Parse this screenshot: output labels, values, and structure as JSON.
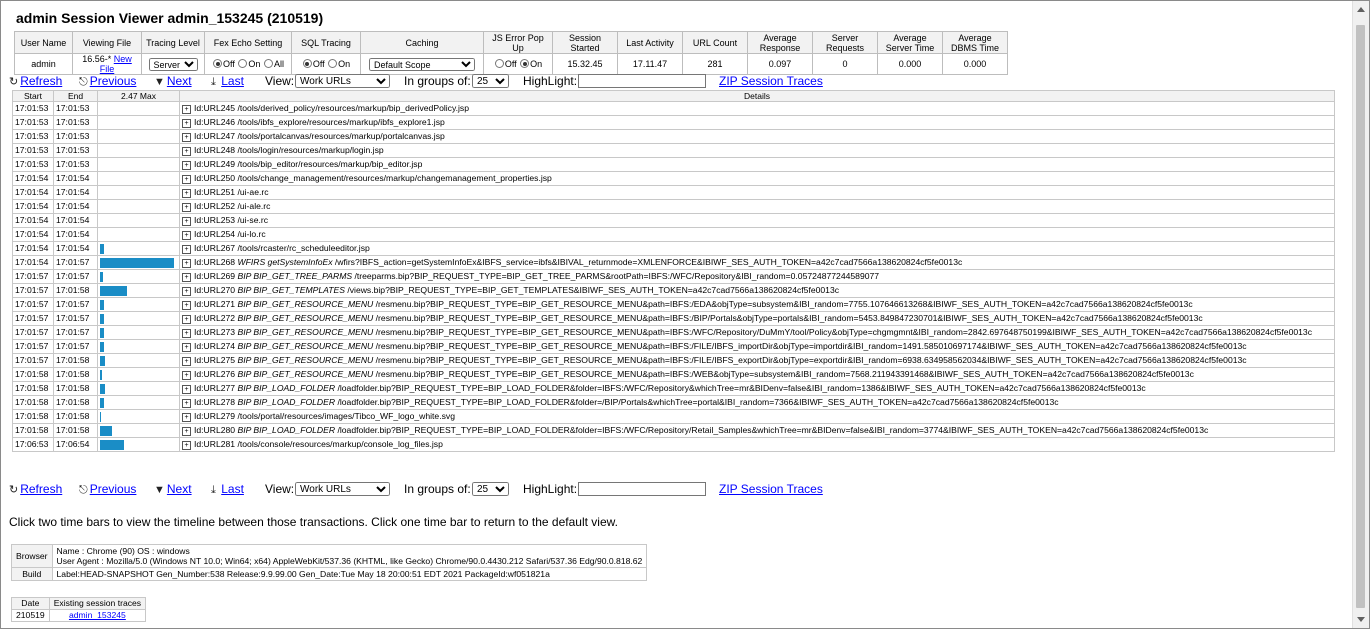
{
  "title": "admin Session Viewer admin_153245 (210519)",
  "summary": {
    "headers": [
      "User Name",
      "Viewing File",
      "Tracing Level",
      "Fex Echo Setting",
      "SQL Tracing",
      "Caching",
      "JS Error Pop Up",
      "Session Started",
      "Last Activity",
      "URL Count",
      "Average Response",
      "Server Requests",
      "Average Server Time",
      "Average DBMS Time"
    ],
    "user": "admin",
    "viewing_file": "16.56-*",
    "new_file_link": "New File",
    "tracing_level": "Server",
    "fex_echo": [
      "Off",
      "On",
      "All"
    ],
    "sql_tracing": [
      "Off",
      "On"
    ],
    "caching": "Default Scope",
    "js_error": [
      "Off",
      "On"
    ],
    "session_started": "15.32.45",
    "last_activity": "17.11.47",
    "url_count": "281",
    "avg_response": "0.097",
    "server_requests": "0",
    "avg_server_time": "0.000",
    "avg_dbms_time": "0.000"
  },
  "toolbar": {
    "refresh": "Refresh",
    "previous": "Previous",
    "next": "Next",
    "last": "Last",
    "view_label": "View:",
    "view_value": "Work URLs",
    "groups_label": "In groups of:",
    "groups_value": "25",
    "highlight_label": "HighLight:",
    "zip": "ZIP Session Traces"
  },
  "grid": {
    "headers": [
      "Start",
      "End",
      "2.47 Max",
      "Details"
    ],
    "rows": [
      {
        "start": "17:01:53",
        "end": "17:01:53",
        "bar": 0,
        "id": "Id:URL245",
        "label": "",
        "path": "/tools/derived_policy/resources/markup/bip_derivedPolicy.jsp"
      },
      {
        "start": "17:01:53",
        "end": "17:01:53",
        "bar": 0,
        "id": "Id:URL246",
        "label": "",
        "path": "/tools/ibfs_explore/resources/markup/ibfs_explore1.jsp"
      },
      {
        "start": "17:01:53",
        "end": "17:01:53",
        "bar": 0,
        "id": "Id:URL247",
        "label": "",
        "path": "/tools/portalcanvas/resources/markup/portalcanvas.jsp"
      },
      {
        "start": "17:01:53",
        "end": "17:01:53",
        "bar": 0,
        "id": "Id:URL248",
        "label": "",
        "path": "/tools/login/resources/markup/login.jsp"
      },
      {
        "start": "17:01:53",
        "end": "17:01:53",
        "bar": 0,
        "id": "Id:URL249",
        "label": "",
        "path": "/tools/bip_editor/resources/markup/bip_editor.jsp"
      },
      {
        "start": "17:01:54",
        "end": "17:01:54",
        "bar": 0,
        "id": "Id:URL250",
        "label": "",
        "path": "/tools/change_management/resources/markup/changemanagement_properties.jsp"
      },
      {
        "start": "17:01:54",
        "end": "17:01:54",
        "bar": 0,
        "id": "Id:URL251",
        "label": "",
        "path": "/ui-ae.rc"
      },
      {
        "start": "17:01:54",
        "end": "17:01:54",
        "bar": 0,
        "id": "Id:URL252",
        "label": "",
        "path": "/ui-ale.rc"
      },
      {
        "start": "17:01:54",
        "end": "17:01:54",
        "bar": 0,
        "id": "Id:URL253",
        "label": "",
        "path": "/ui-se.rc"
      },
      {
        "start": "17:01:54",
        "end": "17:01:54",
        "bar": 0,
        "id": "Id:URL254",
        "label": "",
        "path": "/ui-lo.rc"
      },
      {
        "start": "17:01:54",
        "end": "17:01:54",
        "bar": 0.05,
        "id": "Id:URL267",
        "label": "",
        "path": "/tools/rcaster/rc_scheduleeditor.jsp"
      },
      {
        "start": "17:01:54",
        "end": "17:01:57",
        "bar": 1,
        "id": "Id:URL268",
        "label": "WFIRS getSystemInfoEx",
        "path": "/wfirs?IBFS_action=getSystemInfoEx&IBFS_service=ibfs&IBIVAL_returnmode=XMLENFORCE&IBIWF_SES_AUTH_TOKEN=a42c7cad7566a138620824cf5fe0013c"
      },
      {
        "start": "17:01:57",
        "end": "17:01:57",
        "bar": 0.04,
        "id": "Id:URL269",
        "label": "BIP BIP_GET_TREE_PARMS",
        "path": "/treeparms.bip?BIP_REQUEST_TYPE=BIP_GET_TREE_PARMS&rootPath=IBFS:/WFC/Repository&IBI_random=0.05724877244589077"
      },
      {
        "start": "17:01:57",
        "end": "17:01:58",
        "bar": 0.36,
        "id": "Id:URL270",
        "label": "BIP BIP_GET_TEMPLATES",
        "path": "/views.bip?BIP_REQUEST_TYPE=BIP_GET_TEMPLATES&IBIWF_SES_AUTH_TOKEN=a42c7cad7566a138620824cf5fe0013c"
      },
      {
        "start": "17:01:57",
        "end": "17:01:57",
        "bar": 0.06,
        "id": "Id:URL271",
        "label": "BIP BIP_GET_RESOURCE_MENU",
        "path": "/resmenu.bip?BIP_REQUEST_TYPE=BIP_GET_RESOURCE_MENU&path=IBFS:/EDA&objType=subsystem&IBI_random=7755.107646613268&IBIWF_SES_AUTH_TOKEN=a42c7cad7566a138620824cf5fe0013c"
      },
      {
        "start": "17:01:57",
        "end": "17:01:57",
        "bar": 0.05,
        "id": "Id:URL272",
        "label": "BIP BIP_GET_RESOURCE_MENU",
        "path": "/resmenu.bip?BIP_REQUEST_TYPE=BIP_GET_RESOURCE_MENU&path=IBFS:/BIP/Portals&objType=portals&IBI_random=5453.849847230701&IBIWF_SES_AUTH_TOKEN=a42c7cad7566a138620824cf5fe0013c"
      },
      {
        "start": "17:01:57",
        "end": "17:01:57",
        "bar": 0.05,
        "id": "Id:URL273",
        "label": "BIP BIP_GET_RESOURCE_MENU",
        "path": "/resmenu.bip?BIP_REQUEST_TYPE=BIP_GET_RESOURCE_MENU&path=IBFS:/WFC/Repository/DuMmY/tool/Policy&objType=chgmgmnt&IBI_random=2842.697648750199&IBIWF_SES_AUTH_TOKEN=a42c7cad7566a138620824cf5fe0013c"
      },
      {
        "start": "17:01:57",
        "end": "17:01:57",
        "bar": 0.05,
        "id": "Id:URL274",
        "label": "BIP BIP_GET_RESOURCE_MENU",
        "path": "/resmenu.bip?BIP_REQUEST_TYPE=BIP_GET_RESOURCE_MENU&path=IBFS:/FILE/IBFS_importDir&objType=importdir&IBI_random=1491.585010697174&IBIWF_SES_AUTH_TOKEN=a42c7cad7566a138620824cf5fe0013c"
      },
      {
        "start": "17:01:57",
        "end": "17:01:58",
        "bar": 0.07,
        "id": "Id:URL275",
        "label": "BIP BIP_GET_RESOURCE_MENU",
        "path": "/resmenu.bip?BIP_REQUEST_TYPE=BIP_GET_RESOURCE_MENU&path=IBFS:/FILE/IBFS_exportDir&objType=exportdir&IBI_random=6938.634958562034&IBIWF_SES_AUTH_TOKEN=a42c7cad7566a138620824cf5fe0013c"
      },
      {
        "start": "17:01:58",
        "end": "17:01:58",
        "bar": 0.03,
        "id": "Id:URL276",
        "label": "BIP BIP_GET_RESOURCE_MENU",
        "path": "/resmenu.bip?BIP_REQUEST_TYPE=BIP_GET_RESOURCE_MENU&path=IBFS:/WEB&objType=subsystem&IBI_random=7568.211943391468&IBIWF_SES_AUTH_TOKEN=a42c7cad7566a138620824cf5fe0013c"
      },
      {
        "start": "17:01:58",
        "end": "17:01:58",
        "bar": 0.07,
        "id": "Id:URL277",
        "label": "BIP BIP_LOAD_FOLDER",
        "path": "/loadfolder.bip?BIP_REQUEST_TYPE=BIP_LOAD_FOLDER&folder=IBFS:/WFC/Repository&whichTree=mr&BIDenv=false&IBI_random=1386&IBIWF_SES_AUTH_TOKEN=a42c7cad7566a138620824cf5fe0013c"
      },
      {
        "start": "17:01:58",
        "end": "17:01:58",
        "bar": 0.06,
        "id": "Id:URL278",
        "label": "BIP BIP_LOAD_FOLDER",
        "path": "/loadfolder.bip?BIP_REQUEST_TYPE=BIP_LOAD_FOLDER&folder=/BIP/Portals&whichTree=portal&IBI_random=7366&IBIWF_SES_AUTH_TOKEN=a42c7cad7566a138620824cf5fe0013c"
      },
      {
        "start": "17:01:58",
        "end": "17:01:58",
        "bar": 0.02,
        "id": "Id:URL279",
        "label": "",
        "path": "/tools/portal/resources/images/Tibco_WF_logo_white.svg"
      },
      {
        "start": "17:01:58",
        "end": "17:01:58",
        "bar": 0.16,
        "id": "Id:URL280",
        "label": "BIP BIP_LOAD_FOLDER",
        "path": "/loadfolder.bip?BIP_REQUEST_TYPE=BIP_LOAD_FOLDER&folder=IBFS:/WFC/Repository/Retail_Samples&whichTree=mr&BIDenv=false&IBI_random=3774&IBIWF_SES_AUTH_TOKEN=a42c7cad7566a138620824cf5fe0013c"
      },
      {
        "start": "17:06:53",
        "end": "17:06:54",
        "bar": 0.33,
        "id": "Id:URL281",
        "label": "",
        "path": "/tools/console/resources/markup/console_log_files.jsp"
      }
    ]
  },
  "hint": "Click two time bars to view the timeline between those transactions. Click one time bar to return to the default view.",
  "info": {
    "browser_label": "Browser",
    "browser_line1": "Name : Chrome (90)  OS : windows",
    "browser_line2": "User Agent : Mozilla/5.0 (Windows NT 10.0; Win64; x64) AppleWebKit/537.36 (KHTML, like Gecko) Chrome/90.0.4430.212 Safari/537.36 Edg/90.0.818.62",
    "build_label": "Build",
    "build_value": "Label:HEAD-SNAPSHOT Gen_Number:538 Release:9.9.99.00 Gen_Date:Tue May 18 20:00:51 EDT 2021 PackageId:wf051821a"
  },
  "traces": {
    "headers": [
      "Date",
      "Existing session traces"
    ],
    "date": "210519",
    "link": "admin_153245"
  },
  "colors": {
    "bar": "#1a8dc6",
    "link": "#0000ff",
    "header_bg": "#f2f2f2"
  },
  "icons": {
    "refresh": "refresh-icon",
    "previous": "previous-icon",
    "next": "next-icon",
    "last": "last-icon",
    "expand": "plus-box-icon"
  }
}
